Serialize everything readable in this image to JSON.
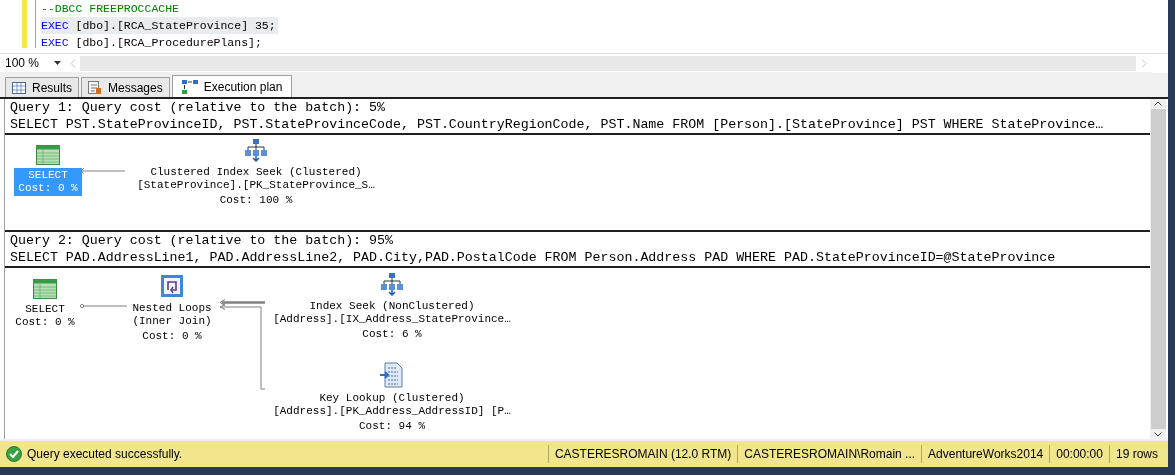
{
  "editor": {
    "lines": [
      {
        "highlighted": false,
        "tokens": [
          {
            "kind": "comment",
            "text": "--DBCC FREEPROCCACHE"
          }
        ]
      },
      {
        "highlighted": true,
        "tokens": [
          {
            "kind": "keyword",
            "text": "EXEC"
          },
          {
            "kind": "plain",
            "text": " [dbo].[RCA_StateProvince] 35;"
          }
        ]
      },
      {
        "highlighted": false,
        "tokens": [
          {
            "kind": "keyword",
            "text": "EXEC"
          },
          {
            "kind": "plain",
            "text": " [dbo].[RCA_ProcedurePlans];"
          }
        ]
      }
    ]
  },
  "zoom": {
    "value": "100 %"
  },
  "tabs": [
    {
      "label": "Results",
      "kind": "grid",
      "selected": false
    },
    {
      "label": "Messages",
      "kind": "messages",
      "selected": false
    },
    {
      "label": "Execution plan",
      "kind": "plan",
      "selected": true
    }
  ],
  "queries": [
    {
      "header": "Query 1: Query cost (relative to the batch): 5%",
      "sql": "SELECT PST.StateProvinceID, PST.StateProvinceCode, PST.CountryRegionCode, PST.Name FROM [Person].[StateProvince] PST WHERE StateProvince…",
      "nodes": [
        {
          "kind": "select",
          "selected": true,
          "lines": [
            "SELECT",
            "Cost: 0 %"
          ]
        },
        {
          "kind": "index_seek",
          "selected": false,
          "lines": [
            "Clustered Index Seek (Clustered)",
            "[StateProvince].[PK_StateProvince_S…",
            "Cost: 100 %"
          ]
        }
      ]
    },
    {
      "header": "Query 2: Query cost (relative to the batch): 95%",
      "sql": "SELECT PAD.AddressLine1, PAD.AddressLine2, PAD.City,PAD.PostalCode FROM Person.Address PAD WHERE PAD.StateProvinceID=@StateProvince",
      "nodes": [
        {
          "kind": "select",
          "selected": false,
          "lines": [
            "SELECT",
            "Cost: 0 %"
          ]
        },
        {
          "kind": "nested_loops",
          "selected": false,
          "lines": [
            "Nested Loops",
            "(Inner Join)",
            "Cost: 0 %"
          ]
        },
        {
          "kind": "index_seek",
          "selected": false,
          "lines": [
            "Index Seek (NonClustered)",
            "[Address].[IX_Address_StateProvince…",
            "Cost: 6 %"
          ]
        },
        {
          "kind": "key_lookup",
          "selected": false,
          "lines": [
            "Key Lookup (Clustered)",
            "[Address].[PK_Address_AddressID] [P…",
            "Cost: 94 %"
          ]
        }
      ]
    }
  ],
  "status_bar": {
    "message": "Query executed successfully.",
    "items": [
      "CASTERESROMAIN (12.0 RTM)",
      "CASTERESROMAIN\\Romain ...",
      "AdventureWorks2014",
      "00:00:00",
      "19 rows"
    ]
  }
}
